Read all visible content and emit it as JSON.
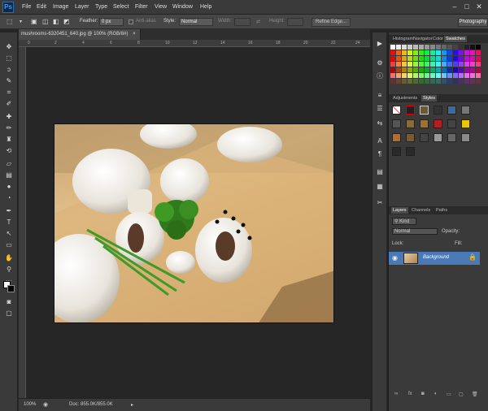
{
  "app": {
    "logo": "Ps",
    "workspace": "Photography"
  },
  "menu": [
    "File",
    "Edit",
    "Image",
    "Layer",
    "Type",
    "Select",
    "Filter",
    "View",
    "Window",
    "Help"
  ],
  "window_buttons": [
    "–",
    "□",
    "✕"
  ],
  "options": {
    "feather_label": "Feather:",
    "feather_value": "0 px",
    "antialias_label": "Anti-alias",
    "style_label": "Style:",
    "style_value": "Normal",
    "width_label": "Width:",
    "height_label": "Height:",
    "refine_edge": "Refine Edge..."
  },
  "document": {
    "tab_title": "mushrooms-6320451_640.jpg @ 100% (RGB/8#)",
    "close": "×"
  },
  "ruler": [
    "0",
    "2",
    "4",
    "6",
    "8",
    "10",
    "12",
    "14",
    "16",
    "18",
    "20",
    "22",
    "24"
  ],
  "status": {
    "zoom": "100%",
    "doc": "Doc: 855.0K/855.0K"
  },
  "panels": {
    "swatches_tabs": [
      "Histogram",
      "Navigator",
      "Color",
      "Swatches"
    ],
    "styles_tabs": [
      "Adjustments",
      "Styles"
    ],
    "layers_tabs": [
      "Layers",
      "Channels",
      "Paths"
    ],
    "kind": "Kind",
    "blend_mode": "Normal",
    "opacity_label": "Opacity:",
    "lock_label": "Lock:",
    "fill_label": "Fill:",
    "layer_name": "Background"
  },
  "colors": {
    "accent": "#4b79b5",
    "logo": "#2d6ab0"
  }
}
